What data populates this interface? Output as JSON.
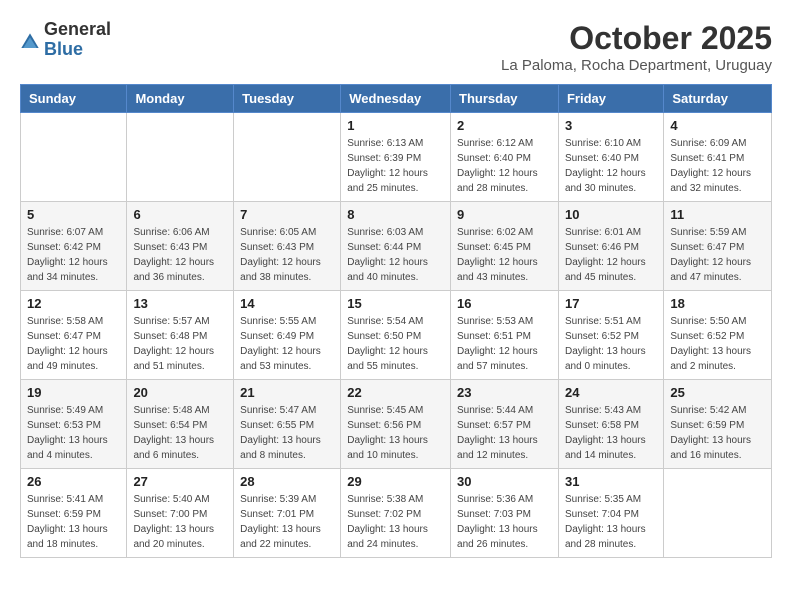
{
  "logo": {
    "general": "General",
    "blue": "Blue"
  },
  "title": "October 2025",
  "subtitle": "La Paloma, Rocha Department, Uruguay",
  "days_of_week": [
    "Sunday",
    "Monday",
    "Tuesday",
    "Wednesday",
    "Thursday",
    "Friday",
    "Saturday"
  ],
  "weeks": [
    [
      {
        "num": "",
        "info": ""
      },
      {
        "num": "",
        "info": ""
      },
      {
        "num": "",
        "info": ""
      },
      {
        "num": "1",
        "info": "Sunrise: 6:13 AM\nSunset: 6:39 PM\nDaylight: 12 hours\nand 25 minutes."
      },
      {
        "num": "2",
        "info": "Sunrise: 6:12 AM\nSunset: 6:40 PM\nDaylight: 12 hours\nand 28 minutes."
      },
      {
        "num": "3",
        "info": "Sunrise: 6:10 AM\nSunset: 6:40 PM\nDaylight: 12 hours\nand 30 minutes."
      },
      {
        "num": "4",
        "info": "Sunrise: 6:09 AM\nSunset: 6:41 PM\nDaylight: 12 hours\nand 32 minutes."
      }
    ],
    [
      {
        "num": "5",
        "info": "Sunrise: 6:07 AM\nSunset: 6:42 PM\nDaylight: 12 hours\nand 34 minutes."
      },
      {
        "num": "6",
        "info": "Sunrise: 6:06 AM\nSunset: 6:43 PM\nDaylight: 12 hours\nand 36 minutes."
      },
      {
        "num": "7",
        "info": "Sunrise: 6:05 AM\nSunset: 6:43 PM\nDaylight: 12 hours\nand 38 minutes."
      },
      {
        "num": "8",
        "info": "Sunrise: 6:03 AM\nSunset: 6:44 PM\nDaylight: 12 hours\nand 40 minutes."
      },
      {
        "num": "9",
        "info": "Sunrise: 6:02 AM\nSunset: 6:45 PM\nDaylight: 12 hours\nand 43 minutes."
      },
      {
        "num": "10",
        "info": "Sunrise: 6:01 AM\nSunset: 6:46 PM\nDaylight: 12 hours\nand 45 minutes."
      },
      {
        "num": "11",
        "info": "Sunrise: 5:59 AM\nSunset: 6:47 PM\nDaylight: 12 hours\nand 47 minutes."
      }
    ],
    [
      {
        "num": "12",
        "info": "Sunrise: 5:58 AM\nSunset: 6:47 PM\nDaylight: 12 hours\nand 49 minutes."
      },
      {
        "num": "13",
        "info": "Sunrise: 5:57 AM\nSunset: 6:48 PM\nDaylight: 12 hours\nand 51 minutes."
      },
      {
        "num": "14",
        "info": "Sunrise: 5:55 AM\nSunset: 6:49 PM\nDaylight: 12 hours\nand 53 minutes."
      },
      {
        "num": "15",
        "info": "Sunrise: 5:54 AM\nSunset: 6:50 PM\nDaylight: 12 hours\nand 55 minutes."
      },
      {
        "num": "16",
        "info": "Sunrise: 5:53 AM\nSunset: 6:51 PM\nDaylight: 12 hours\nand 57 minutes."
      },
      {
        "num": "17",
        "info": "Sunrise: 5:51 AM\nSunset: 6:52 PM\nDaylight: 13 hours\nand 0 minutes."
      },
      {
        "num": "18",
        "info": "Sunrise: 5:50 AM\nSunset: 6:52 PM\nDaylight: 13 hours\nand 2 minutes."
      }
    ],
    [
      {
        "num": "19",
        "info": "Sunrise: 5:49 AM\nSunset: 6:53 PM\nDaylight: 13 hours\nand 4 minutes."
      },
      {
        "num": "20",
        "info": "Sunrise: 5:48 AM\nSunset: 6:54 PM\nDaylight: 13 hours\nand 6 minutes."
      },
      {
        "num": "21",
        "info": "Sunrise: 5:47 AM\nSunset: 6:55 PM\nDaylight: 13 hours\nand 8 minutes."
      },
      {
        "num": "22",
        "info": "Sunrise: 5:45 AM\nSunset: 6:56 PM\nDaylight: 13 hours\nand 10 minutes."
      },
      {
        "num": "23",
        "info": "Sunrise: 5:44 AM\nSunset: 6:57 PM\nDaylight: 13 hours\nand 12 minutes."
      },
      {
        "num": "24",
        "info": "Sunrise: 5:43 AM\nSunset: 6:58 PM\nDaylight: 13 hours\nand 14 minutes."
      },
      {
        "num": "25",
        "info": "Sunrise: 5:42 AM\nSunset: 6:59 PM\nDaylight: 13 hours\nand 16 minutes."
      }
    ],
    [
      {
        "num": "26",
        "info": "Sunrise: 5:41 AM\nSunset: 6:59 PM\nDaylight: 13 hours\nand 18 minutes."
      },
      {
        "num": "27",
        "info": "Sunrise: 5:40 AM\nSunset: 7:00 PM\nDaylight: 13 hours\nand 20 minutes."
      },
      {
        "num": "28",
        "info": "Sunrise: 5:39 AM\nSunset: 7:01 PM\nDaylight: 13 hours\nand 22 minutes."
      },
      {
        "num": "29",
        "info": "Sunrise: 5:38 AM\nSunset: 7:02 PM\nDaylight: 13 hours\nand 24 minutes."
      },
      {
        "num": "30",
        "info": "Sunrise: 5:36 AM\nSunset: 7:03 PM\nDaylight: 13 hours\nand 26 minutes."
      },
      {
        "num": "31",
        "info": "Sunrise: 5:35 AM\nSunset: 7:04 PM\nDaylight: 13 hours\nand 28 minutes."
      },
      {
        "num": "",
        "info": ""
      }
    ]
  ]
}
